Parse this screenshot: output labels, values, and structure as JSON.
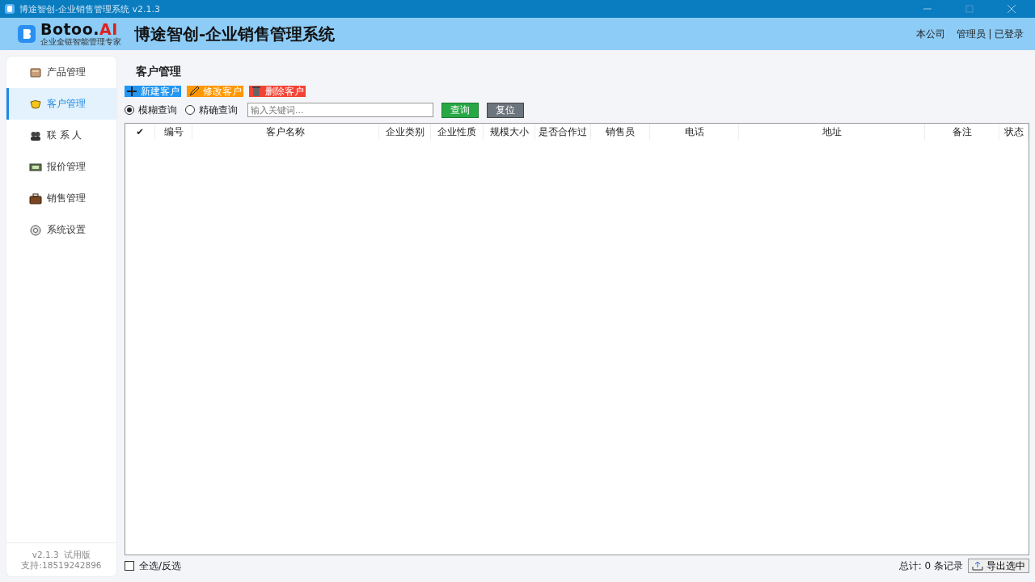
{
  "window": {
    "title": "博途智创-企业销售管理系统 v2.1.3"
  },
  "header": {
    "logo_text": "Botoo.",
    "logo_accent": "AI",
    "logo_tagline": "企业全链智能管理专家",
    "app_title": "博途智创-企业销售管理系统",
    "company": "本公司",
    "user": "管理员 | 已登录"
  },
  "sidebar": {
    "items": [
      {
        "label": "产品管理",
        "selected": false
      },
      {
        "label": "客户管理",
        "selected": true
      },
      {
        "label": "联 系 人",
        "selected": false
      },
      {
        "label": "报价管理",
        "selected": false
      },
      {
        "label": "销售管理",
        "selected": false
      },
      {
        "label": "系统设置",
        "selected": false
      }
    ],
    "version": "v2.1.3  试用版",
    "support": "支持:18519242896"
  },
  "page": {
    "title": "客户管理",
    "toolbar": [
      {
        "kind": "add",
        "label": "新建客户",
        "color": "#2196f3"
      },
      {
        "kind": "edit",
        "label": "修改客户",
        "color": "#ff9800"
      },
      {
        "kind": "delete",
        "label": "删除客户",
        "color": "#f44336"
      }
    ],
    "search_modes": [
      {
        "label": "模糊查询",
        "selected": true
      },
      {
        "label": "精确查询",
        "selected": false
      }
    ],
    "search": {
      "placeholder": "输入关键词..."
    },
    "buttons": [
      {
        "kind": "query",
        "label": "查询"
      },
      {
        "kind": "reset",
        "label": "复位"
      }
    ],
    "table": {
      "columns": [
        "✔",
        "编号",
        "客户名称",
        "企业类别",
        "企业性质",
        "规模大小",
        "是否合作过",
        "销售员",
        "电话",
        "地址",
        "备注",
        "状态"
      ]
    },
    "footer": {
      "select_all": {
        "label": "全选/反选",
        "checked": false
      },
      "total": "总计: 0 条记录",
      "export": "导出选中"
    }
  }
}
